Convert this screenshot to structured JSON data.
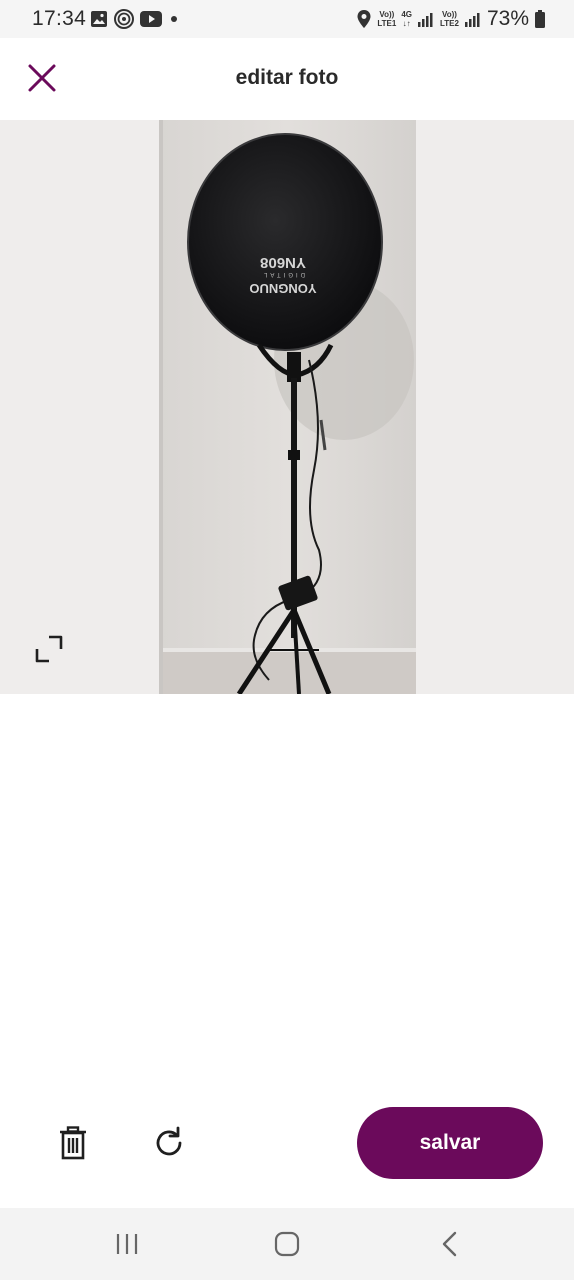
{
  "status_bar": {
    "time": "17:34",
    "left_icons": [
      "image-icon",
      "threads-icon",
      "youtube-icon",
      "dot-icon"
    ],
    "sim1_top": "Vo))",
    "sim1_bottom": "LTE1",
    "net_top": "4G",
    "net_bottom": "↓↑",
    "sim2_top": "Vo))",
    "sim2_bottom": "LTE2",
    "battery": "73%"
  },
  "header": {
    "title": "editar foto",
    "close_icon": "close-icon"
  },
  "photo": {
    "description_icon": "photo",
    "brand_text": "YONGNUO",
    "model_text": "YN608",
    "digital_text": "DIGITAL"
  },
  "toolbar": {
    "delete_icon": "trash-icon",
    "rotate_icon": "rotate-icon",
    "save_label": "salvar"
  },
  "colors": {
    "accent": "#6b0a5b",
    "photo_bg": "#efedec"
  },
  "nav": {
    "recent": "recent-apps-icon",
    "home": "home-icon",
    "back": "back-icon"
  }
}
